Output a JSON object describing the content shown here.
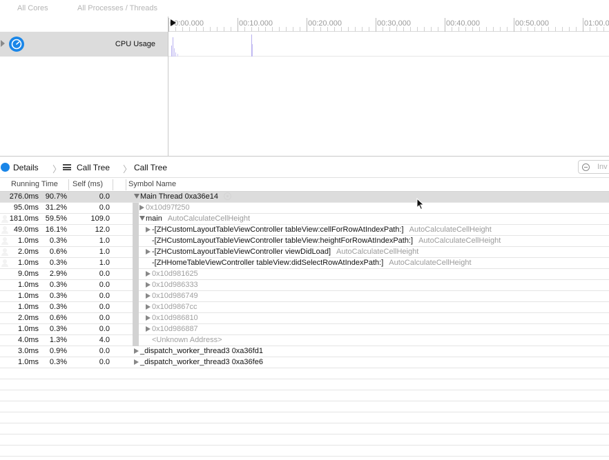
{
  "filters": {
    "cores": "All Cores",
    "processes": "All Processes / Threads"
  },
  "track": {
    "label": "CPU Usage",
    "icon": "gauge-icon"
  },
  "ruler": {
    "ticks": [
      "00:00.000",
      "00:10.000",
      "00:20.000",
      "00:30,000",
      "00:40.000",
      "00:50.000",
      "01:00.0"
    ]
  },
  "nav": {
    "details": "Details",
    "call_tree_1": "Call Tree",
    "call_tree_2": "Call Tree",
    "search_placeholder": "Inv"
  },
  "table": {
    "headers": {
      "running_time": "Running Time",
      "self": "Self (ms)",
      "symbol": "Symbol Name"
    },
    "rows": [
      {
        "ms": "276.0ms",
        "pct": "90.7%",
        "self": "0.0",
        "user": false,
        "disclosure": "down",
        "level": 0,
        "symbol": "Main Thread  0xa36e14",
        "lib": "",
        "focus": true,
        "selected": true
      },
      {
        "ms": "95.0ms",
        "pct": "31.2%",
        "self": "0.0",
        "user": false,
        "disclosure": "right",
        "level": 1,
        "symbol": "0x10d97f250",
        "lib": "",
        "dim": true
      },
      {
        "ms": "181.0ms",
        "pct": "59.5%",
        "self": "109.0",
        "user": true,
        "disclosure": "down",
        "level": 1,
        "symbol": "main",
        "lib": "AutoCalculateCellHeight"
      },
      {
        "ms": "49.0ms",
        "pct": "16.1%",
        "self": "12.0",
        "user": true,
        "disclosure": "right",
        "level": 2,
        "symbol": "-[ZHCustomLayoutTableViewController tableView:cellForRowAtIndexPath:]",
        "lib": "AutoCalculateCellHeight"
      },
      {
        "ms": "1.0ms",
        "pct": "0.3%",
        "self": "1.0",
        "user": true,
        "disclosure": "none",
        "level": 2,
        "symbol": "-[ZHCustomLayoutTableViewController tableView:heightForRowAtIndexPath:]",
        "lib": "AutoCalculateCellHeight"
      },
      {
        "ms": "2.0ms",
        "pct": "0.6%",
        "self": "1.0",
        "user": true,
        "disclosure": "right",
        "level": 2,
        "symbol": "-[ZHCustomLayoutTableViewController viewDidLoad]",
        "lib": "AutoCalculateCellHeight"
      },
      {
        "ms": "1.0ms",
        "pct": "0.3%",
        "self": "1.0",
        "user": true,
        "disclosure": "none",
        "level": 2,
        "symbol": "-[ZHHomeTableViewController tableView:didSelectRowAtIndexPath:]",
        "lib": "AutoCalculateCellHeight"
      },
      {
        "ms": "9.0ms",
        "pct": "2.9%",
        "self": "0.0",
        "user": false,
        "disclosure": "right",
        "level": 2,
        "symbol": "0x10d981625",
        "lib": "",
        "dim": true
      },
      {
        "ms": "1.0ms",
        "pct": "0.3%",
        "self": "0.0",
        "user": false,
        "disclosure": "right",
        "level": 2,
        "symbol": "0x10d986333",
        "lib": "",
        "dim": true
      },
      {
        "ms": "1.0ms",
        "pct": "0.3%",
        "self": "0.0",
        "user": false,
        "disclosure": "right",
        "level": 2,
        "symbol": "0x10d986749",
        "lib": "",
        "dim": true
      },
      {
        "ms": "1.0ms",
        "pct": "0.3%",
        "self": "0.0",
        "user": false,
        "disclosure": "right",
        "level": 2,
        "symbol": "0x10d9867cc",
        "lib": "",
        "dim": true
      },
      {
        "ms": "2.0ms",
        "pct": "0.6%",
        "self": "0.0",
        "user": false,
        "disclosure": "right",
        "level": 2,
        "symbol": "0x10d986810",
        "lib": "",
        "dim": true
      },
      {
        "ms": "1.0ms",
        "pct": "0.3%",
        "self": "0.0",
        "user": false,
        "disclosure": "right",
        "level": 2,
        "symbol": "0x10d986887",
        "lib": "",
        "dim": true
      },
      {
        "ms": "4.0ms",
        "pct": "1.3%",
        "self": "4.0",
        "user": false,
        "disclosure": "none",
        "level": 2,
        "symbol": "<Unknown Address>",
        "lib": "",
        "dim": true
      },
      {
        "ms": "3.0ms",
        "pct": "0.9%",
        "self": "0.0",
        "user": false,
        "disclosure": "right",
        "level": 0,
        "symbol": "_dispatch_worker_thread3  0xa36fd1",
        "lib": ""
      },
      {
        "ms": "1.0ms",
        "pct": "0.3%",
        "self": "0.0",
        "user": false,
        "disclosure": "right",
        "level": 0,
        "symbol": "_dispatch_worker_thread3  0xa36fe6",
        "lib": ""
      }
    ]
  },
  "colors": {
    "accent": "#1a86e8",
    "selection": "#dcdcdc",
    "graph": "#b8b0f0"
  }
}
